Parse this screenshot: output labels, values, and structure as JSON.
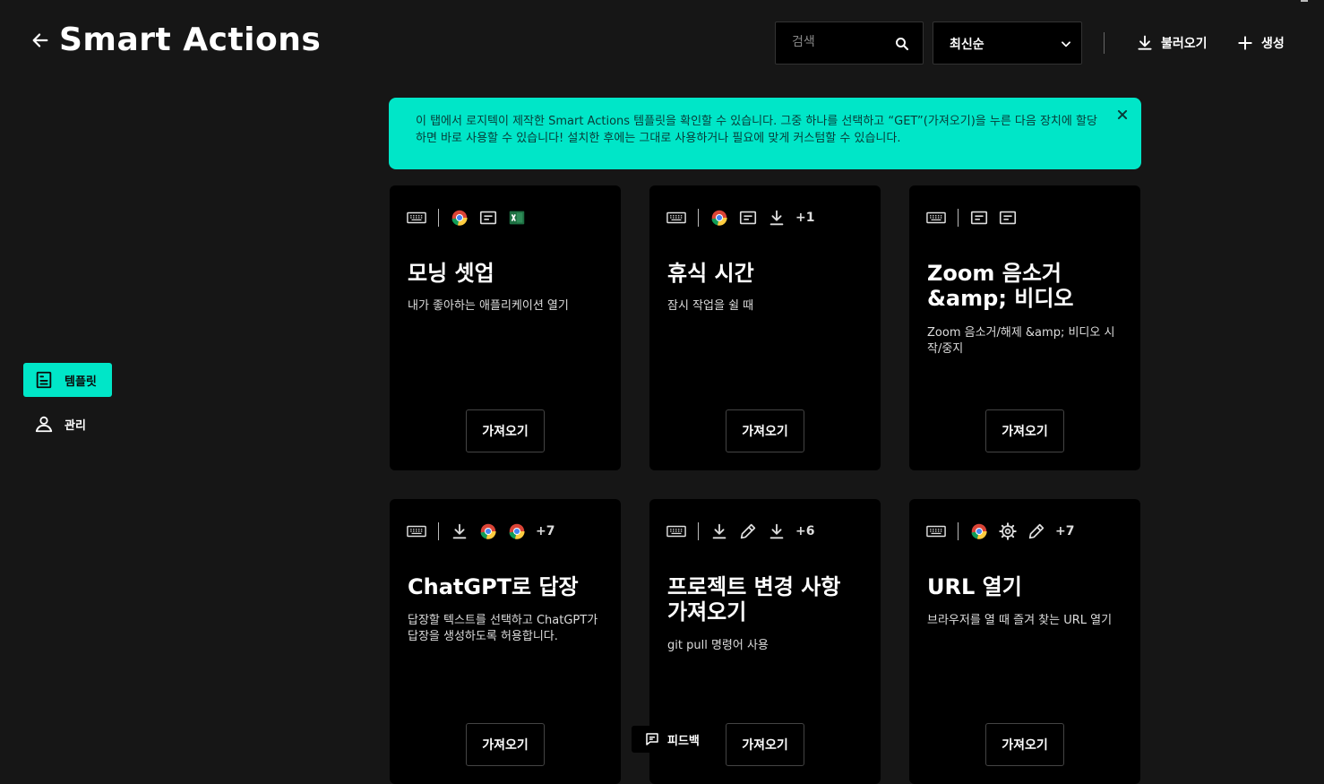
{
  "header": {
    "title": "Smart Actions",
    "search_placeholder": "검색",
    "sort_label": "최신순",
    "import_label": "불러오기",
    "create_label": "생성"
  },
  "sidebar": {
    "items": [
      {
        "label": "템플릿",
        "active": true
      },
      {
        "label": "관리",
        "active": false
      }
    ]
  },
  "banner": {
    "text": "이 탭에서 로지텍이 제작한 Smart Actions 템플릿을 확인할 수 있습니다. 그중 하나를 선택하고 “GET”(가져오기)을 누른 다음 장치에 할당하면 바로 사용할 수 있습니다! 설치한 후에는 그대로 사용하거나 필요에 맞게 커스텀할 수 있습니다."
  },
  "cards": [
    {
      "title": "모닝 셋업",
      "desc": "내가 좋아하는 애플리케이션 열기",
      "get_label": "가져오기",
      "more": ""
    },
    {
      "title": "휴식 시간",
      "desc": "잠시 작업을 쉴 때",
      "get_label": "가져오기",
      "more": "+1"
    },
    {
      "title": "Zoom 음소거 &amp; 비디오",
      "desc": "Zoom 음소거/해제 &amp; 비디오 시작/중지",
      "get_label": "가져오기",
      "more": ""
    },
    {
      "title": "ChatGPT로 답장",
      "desc": "답장할 텍스트를 선택하고 ChatGPT가 답장을 생성하도록 허용합니다.",
      "get_label": "가져오기",
      "more": "+7"
    },
    {
      "title": "프로젝트 변경 사항 가져오기",
      "desc": "git pull 명령어 사용",
      "get_label": "가져오기",
      "more": "+6"
    },
    {
      "title": "URL 열기",
      "desc": "브라우저를 열 때 즐겨 찾는 URL 열기",
      "get_label": "가져오기",
      "more": "+7"
    }
  ],
  "feedback_label": "피드백",
  "colors": {
    "accent": "#00e6c8",
    "background": "#161616",
    "card": "#000000",
    "excel": "#1d6f42"
  }
}
